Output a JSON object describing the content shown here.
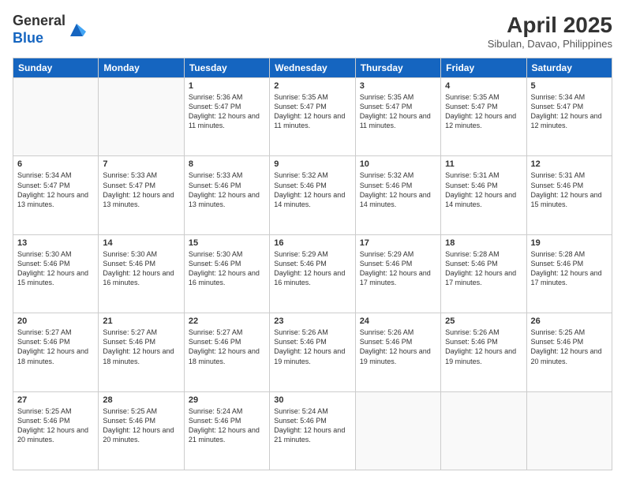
{
  "logo": {
    "line1": "General",
    "line2": "Blue"
  },
  "title": "April 2025",
  "location": "Sibulan, Davao, Philippines",
  "days_of_week": [
    "Sunday",
    "Monday",
    "Tuesday",
    "Wednesday",
    "Thursday",
    "Friday",
    "Saturday"
  ],
  "weeks": [
    [
      {
        "day": "",
        "sunrise": "",
        "sunset": "",
        "daylight": ""
      },
      {
        "day": "",
        "sunrise": "",
        "sunset": "",
        "daylight": ""
      },
      {
        "day": "1",
        "sunrise": "Sunrise: 5:36 AM",
        "sunset": "Sunset: 5:47 PM",
        "daylight": "Daylight: 12 hours and 11 minutes."
      },
      {
        "day": "2",
        "sunrise": "Sunrise: 5:35 AM",
        "sunset": "Sunset: 5:47 PM",
        "daylight": "Daylight: 12 hours and 11 minutes."
      },
      {
        "day": "3",
        "sunrise": "Sunrise: 5:35 AM",
        "sunset": "Sunset: 5:47 PM",
        "daylight": "Daylight: 12 hours and 11 minutes."
      },
      {
        "day": "4",
        "sunrise": "Sunrise: 5:35 AM",
        "sunset": "Sunset: 5:47 PM",
        "daylight": "Daylight: 12 hours and 12 minutes."
      },
      {
        "day": "5",
        "sunrise": "Sunrise: 5:34 AM",
        "sunset": "Sunset: 5:47 PM",
        "daylight": "Daylight: 12 hours and 12 minutes."
      }
    ],
    [
      {
        "day": "6",
        "sunrise": "Sunrise: 5:34 AM",
        "sunset": "Sunset: 5:47 PM",
        "daylight": "Daylight: 12 hours and 13 minutes."
      },
      {
        "day": "7",
        "sunrise": "Sunrise: 5:33 AM",
        "sunset": "Sunset: 5:47 PM",
        "daylight": "Daylight: 12 hours and 13 minutes."
      },
      {
        "day": "8",
        "sunrise": "Sunrise: 5:33 AM",
        "sunset": "Sunset: 5:46 PM",
        "daylight": "Daylight: 12 hours and 13 minutes."
      },
      {
        "day": "9",
        "sunrise": "Sunrise: 5:32 AM",
        "sunset": "Sunset: 5:46 PM",
        "daylight": "Daylight: 12 hours and 14 minutes."
      },
      {
        "day": "10",
        "sunrise": "Sunrise: 5:32 AM",
        "sunset": "Sunset: 5:46 PM",
        "daylight": "Daylight: 12 hours and 14 minutes."
      },
      {
        "day": "11",
        "sunrise": "Sunrise: 5:31 AM",
        "sunset": "Sunset: 5:46 PM",
        "daylight": "Daylight: 12 hours and 14 minutes."
      },
      {
        "day": "12",
        "sunrise": "Sunrise: 5:31 AM",
        "sunset": "Sunset: 5:46 PM",
        "daylight": "Daylight: 12 hours and 15 minutes."
      }
    ],
    [
      {
        "day": "13",
        "sunrise": "Sunrise: 5:30 AM",
        "sunset": "Sunset: 5:46 PM",
        "daylight": "Daylight: 12 hours and 15 minutes."
      },
      {
        "day": "14",
        "sunrise": "Sunrise: 5:30 AM",
        "sunset": "Sunset: 5:46 PM",
        "daylight": "Daylight: 12 hours and 16 minutes."
      },
      {
        "day": "15",
        "sunrise": "Sunrise: 5:30 AM",
        "sunset": "Sunset: 5:46 PM",
        "daylight": "Daylight: 12 hours and 16 minutes."
      },
      {
        "day": "16",
        "sunrise": "Sunrise: 5:29 AM",
        "sunset": "Sunset: 5:46 PM",
        "daylight": "Daylight: 12 hours and 16 minutes."
      },
      {
        "day": "17",
        "sunrise": "Sunrise: 5:29 AM",
        "sunset": "Sunset: 5:46 PM",
        "daylight": "Daylight: 12 hours and 17 minutes."
      },
      {
        "day": "18",
        "sunrise": "Sunrise: 5:28 AM",
        "sunset": "Sunset: 5:46 PM",
        "daylight": "Daylight: 12 hours and 17 minutes."
      },
      {
        "day": "19",
        "sunrise": "Sunrise: 5:28 AM",
        "sunset": "Sunset: 5:46 PM",
        "daylight": "Daylight: 12 hours and 17 minutes."
      }
    ],
    [
      {
        "day": "20",
        "sunrise": "Sunrise: 5:27 AM",
        "sunset": "Sunset: 5:46 PM",
        "daylight": "Daylight: 12 hours and 18 minutes."
      },
      {
        "day": "21",
        "sunrise": "Sunrise: 5:27 AM",
        "sunset": "Sunset: 5:46 PM",
        "daylight": "Daylight: 12 hours and 18 minutes."
      },
      {
        "day": "22",
        "sunrise": "Sunrise: 5:27 AM",
        "sunset": "Sunset: 5:46 PM",
        "daylight": "Daylight: 12 hours and 18 minutes."
      },
      {
        "day": "23",
        "sunrise": "Sunrise: 5:26 AM",
        "sunset": "Sunset: 5:46 PM",
        "daylight": "Daylight: 12 hours and 19 minutes."
      },
      {
        "day": "24",
        "sunrise": "Sunrise: 5:26 AM",
        "sunset": "Sunset: 5:46 PM",
        "daylight": "Daylight: 12 hours and 19 minutes."
      },
      {
        "day": "25",
        "sunrise": "Sunrise: 5:26 AM",
        "sunset": "Sunset: 5:46 PM",
        "daylight": "Daylight: 12 hours and 19 minutes."
      },
      {
        "day": "26",
        "sunrise": "Sunrise: 5:25 AM",
        "sunset": "Sunset: 5:46 PM",
        "daylight": "Daylight: 12 hours and 20 minutes."
      }
    ],
    [
      {
        "day": "27",
        "sunrise": "Sunrise: 5:25 AM",
        "sunset": "Sunset: 5:46 PM",
        "daylight": "Daylight: 12 hours and 20 minutes."
      },
      {
        "day": "28",
        "sunrise": "Sunrise: 5:25 AM",
        "sunset": "Sunset: 5:46 PM",
        "daylight": "Daylight: 12 hours and 20 minutes."
      },
      {
        "day": "29",
        "sunrise": "Sunrise: 5:24 AM",
        "sunset": "Sunset: 5:46 PM",
        "daylight": "Daylight: 12 hours and 21 minutes."
      },
      {
        "day": "30",
        "sunrise": "Sunrise: 5:24 AM",
        "sunset": "Sunset: 5:46 PM",
        "daylight": "Daylight: 12 hours and 21 minutes."
      },
      {
        "day": "",
        "sunrise": "",
        "sunset": "",
        "daylight": ""
      },
      {
        "day": "",
        "sunrise": "",
        "sunset": "",
        "daylight": ""
      },
      {
        "day": "",
        "sunrise": "",
        "sunset": "",
        "daylight": ""
      }
    ]
  ]
}
